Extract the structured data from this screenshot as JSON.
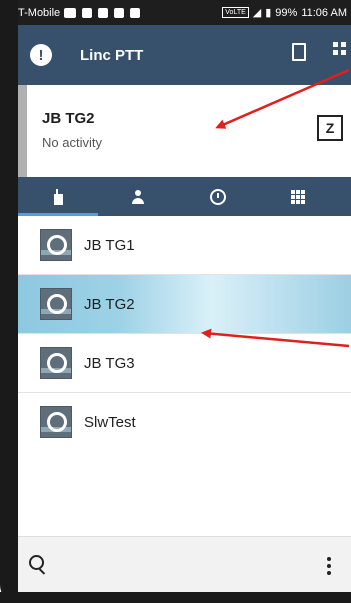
{
  "status_bar": {
    "carrier": "T-Mobile",
    "battery": "99%",
    "time": "11:06 AM",
    "volte_label": "VoLTE"
  },
  "app_bar": {
    "title": "Linc PTT"
  },
  "channel_card": {
    "name": "JB TG2",
    "status": "No activity",
    "action_glyph": "Z"
  },
  "tabs": [
    {
      "icon": "radio-icon",
      "active": true
    },
    {
      "icon": "person-icon",
      "active": false
    },
    {
      "icon": "clock-icon",
      "active": false
    },
    {
      "icon": "dialpad-icon",
      "active": false
    }
  ],
  "channels": [
    {
      "label": "JB TG1",
      "selected": false
    },
    {
      "label": "JB TG2",
      "selected": true
    },
    {
      "label": "JB TG3",
      "selected": false
    },
    {
      "label": "SlwTest",
      "selected": false
    }
  ],
  "colors": {
    "app_bar": "#37506b",
    "tab_indicator": "#4aa3df",
    "selected_row": "#9dd1e6",
    "annotation_arrow": "#e0201c"
  }
}
